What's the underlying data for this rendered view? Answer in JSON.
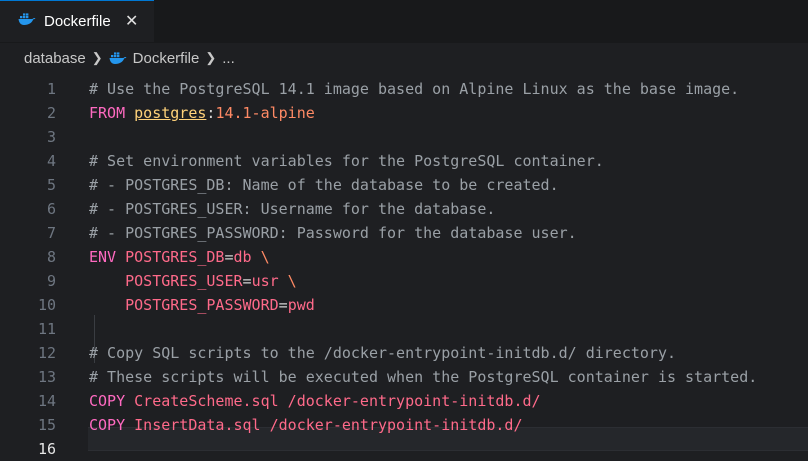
{
  "tab": {
    "label": "Dockerfile",
    "close": "✕"
  },
  "breadcrumb": {
    "folder": "database",
    "file": "Dockerfile",
    "more": "..."
  },
  "colors": {
    "accent": "#0078d4",
    "docker_icon": "#2496ed"
  },
  "editor": {
    "active_line": "16",
    "lines": [
      {
        "num": "1",
        "parts": [
          {
            "t": "# Use the PostgreSQL 14.1 image based on Alpine Linux as the base image.",
            "c": "cmt"
          }
        ]
      },
      {
        "num": "2",
        "parts": [
          {
            "t": "FROM ",
            "c": "kw"
          },
          {
            "t": "postgres",
            "c": "img"
          },
          {
            "t": ":",
            "c": "op"
          },
          {
            "t": "14.1-alpine",
            "c": "tag"
          }
        ]
      },
      {
        "num": "3",
        "parts": []
      },
      {
        "num": "4",
        "parts": [
          {
            "t": "# Set environment variables for the PostgreSQL container.",
            "c": "cmt"
          }
        ]
      },
      {
        "num": "5",
        "parts": [
          {
            "t": "# - POSTGRES_DB: Name of the database to be created.",
            "c": "cmt"
          }
        ]
      },
      {
        "num": "6",
        "parts": [
          {
            "t": "# - POSTGRES_USER: Username for the database.",
            "c": "cmt"
          }
        ]
      },
      {
        "num": "7",
        "parts": [
          {
            "t": "# - POSTGRES_PASSWORD: Password for the database user.",
            "c": "cmt"
          }
        ]
      },
      {
        "num": "8",
        "parts": [
          {
            "t": "ENV ",
            "c": "kw"
          },
          {
            "t": "POSTGRES_DB",
            "c": "var"
          },
          {
            "t": "=",
            "c": "op"
          },
          {
            "t": "db",
            "c": "val"
          },
          {
            "t": " \\",
            "c": "tag"
          }
        ]
      },
      {
        "num": "9",
        "parts": [
          {
            "t": "    POSTGRES_USER",
            "c": "var"
          },
          {
            "t": "=",
            "c": "op"
          },
          {
            "t": "usr",
            "c": "val"
          },
          {
            "t": " \\",
            "c": "tag"
          }
        ]
      },
      {
        "num": "10",
        "parts": [
          {
            "t": "    POSTGRES_PASSWORD",
            "c": "var"
          },
          {
            "t": "=",
            "c": "op"
          },
          {
            "t": "pwd",
            "c": "val"
          }
        ]
      },
      {
        "num": "11",
        "parts": []
      },
      {
        "num": "12",
        "parts": [
          {
            "t": "# Copy SQL scripts to the /docker-entrypoint-initdb.d/ directory.",
            "c": "cmt"
          }
        ]
      },
      {
        "num": "13",
        "parts": [
          {
            "t": "# These scripts will be executed when the PostgreSQL container is started.",
            "c": "cmt"
          }
        ]
      },
      {
        "num": "14",
        "parts": [
          {
            "t": "COPY ",
            "c": "kw"
          },
          {
            "t": "CreateScheme.sql /docker-entrypoint-initdb.d/",
            "c": "path"
          }
        ]
      },
      {
        "num": "15",
        "parts": [
          {
            "t": "COPY ",
            "c": "kw"
          },
          {
            "t": "InsertData.sql /docker-entrypoint-initdb.d/",
            "c": "path"
          }
        ]
      },
      {
        "num": "16",
        "parts": []
      }
    ]
  }
}
